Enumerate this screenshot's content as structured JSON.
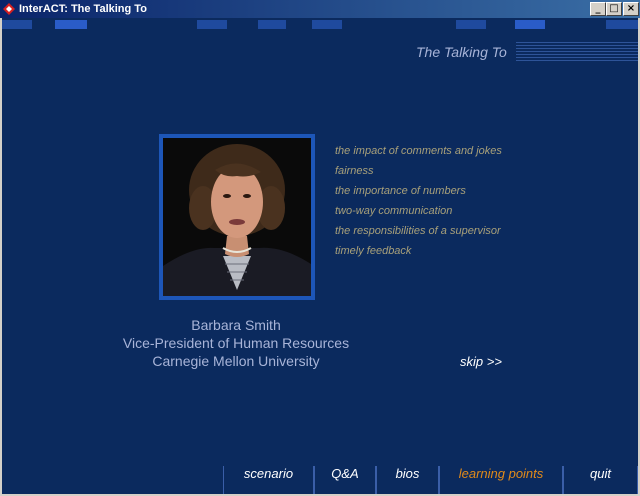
{
  "window": {
    "title": "InterACT: The Talking To",
    "minimize": "_",
    "maximize": "□",
    "close": "×"
  },
  "section_title": "The Talking To",
  "person": {
    "name": "Barbara Smith",
    "role": "Vice-President of Human Resources",
    "org": "Carnegie Mellon University"
  },
  "topics": [
    "the impact of comments and jokes",
    "fairness",
    "the importance of numbers",
    "two-way communication",
    "the responsibilities of a supervisor",
    "timely feedback"
  ],
  "skip_label": "skip >>",
  "nav": {
    "scenario": "scenario",
    "qa": "Q&A",
    "bios": "bios",
    "learning_points": "learning points",
    "quit": "quit",
    "active": "learning points"
  },
  "colors": {
    "background": "#0b2a5e",
    "text": "#a8b4d8",
    "topic_text": "#a8a07a",
    "active_nav": "#e08a1a",
    "portrait_border": "#1d56b8"
  }
}
